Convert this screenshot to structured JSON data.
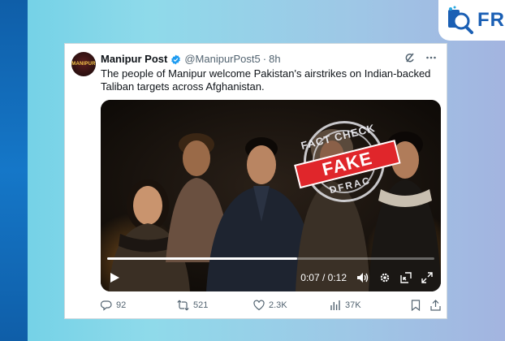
{
  "brand": {
    "text": "FRA"
  },
  "tweet": {
    "author_name": "Manipur Post",
    "handle": "@ManipurPost5",
    "time_sep": "·",
    "time": "8h",
    "avatar_text": "MANIPUR",
    "text": "The people of Manipur welcome Pakistan's airstrikes on Indian-backed Taliban targets across Afghanistan.",
    "video": {
      "stamp_top": "FACT CHECK",
      "stamp_label": "FAKE",
      "stamp_bottom": "DFRAC",
      "current_time": "0:07",
      "duration": "0:12",
      "time_sep": " / ",
      "progress": 0.58
    },
    "actions": {
      "replies": "92",
      "reposts": "521",
      "likes": "2.3K",
      "views": "37K"
    }
  },
  "colors": {
    "verified": "#1d9bf0",
    "fake_red": "#e0262b",
    "brand_blue": "#1a5fb4"
  }
}
